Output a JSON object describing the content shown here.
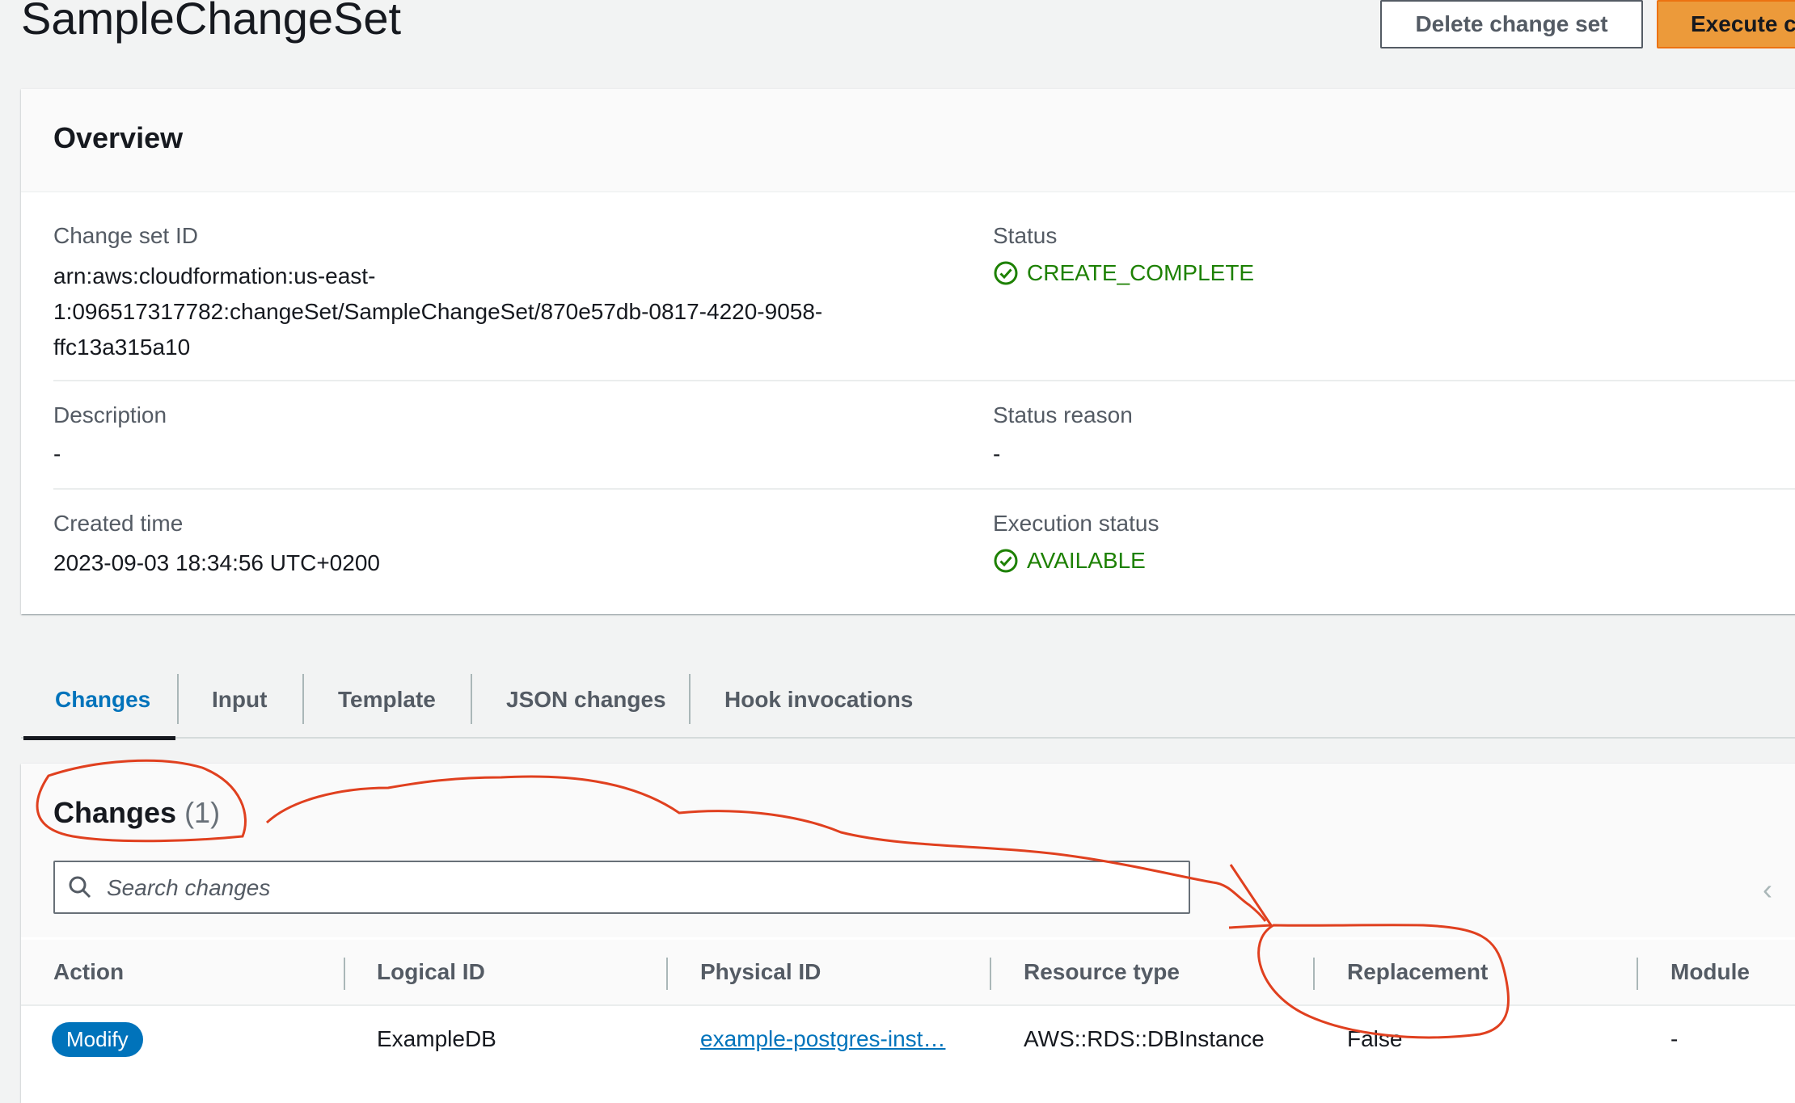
{
  "header": {
    "title": "SampleChangeSet",
    "delete_label": "Delete change set",
    "execute_label": "Execute c"
  },
  "overview": {
    "title": "Overview",
    "change_set_id_label": "Change set ID",
    "change_set_id_line1": "arn:aws:cloudformation:us-east-",
    "change_set_id_line2": "1:096517317782:changeSet/SampleChangeSet/870e57db-0817-4220-9058-",
    "change_set_id_line3": "ffc13a315a10",
    "status_label": "Status",
    "status_value": "CREATE_COMPLETE",
    "description_label": "Description",
    "description_value": "-",
    "status_reason_label": "Status reason",
    "status_reason_value": "-",
    "created_time_label": "Created time",
    "created_time_value": "2023-09-03 18:34:56 UTC+0200",
    "execution_status_label": "Execution status",
    "execution_status_value": "AVAILABLE"
  },
  "tabs": [
    {
      "label": "Changes",
      "active": true
    },
    {
      "label": "Input"
    },
    {
      "label": "Template"
    },
    {
      "label": "JSON changes"
    },
    {
      "label": "Hook invocations"
    }
  ],
  "changes": {
    "title": "Changes",
    "count": "(1)",
    "search_placeholder": "Search changes",
    "columns": [
      "Action",
      "Logical ID",
      "Physical ID",
      "Resource type",
      "Replacement",
      "Module"
    ],
    "rows": [
      {
        "action": "Modify",
        "logical_id": "ExampleDB",
        "physical_id": "example-postgres-inst…",
        "resource_type": "AWS::RDS::DBInstance",
        "replacement": "False",
        "module": "-"
      }
    ]
  },
  "colors": {
    "success": "#1d8102",
    "link": "#0073bb",
    "primary_button": "#ec9a3a",
    "annotation": "#e0401f"
  }
}
